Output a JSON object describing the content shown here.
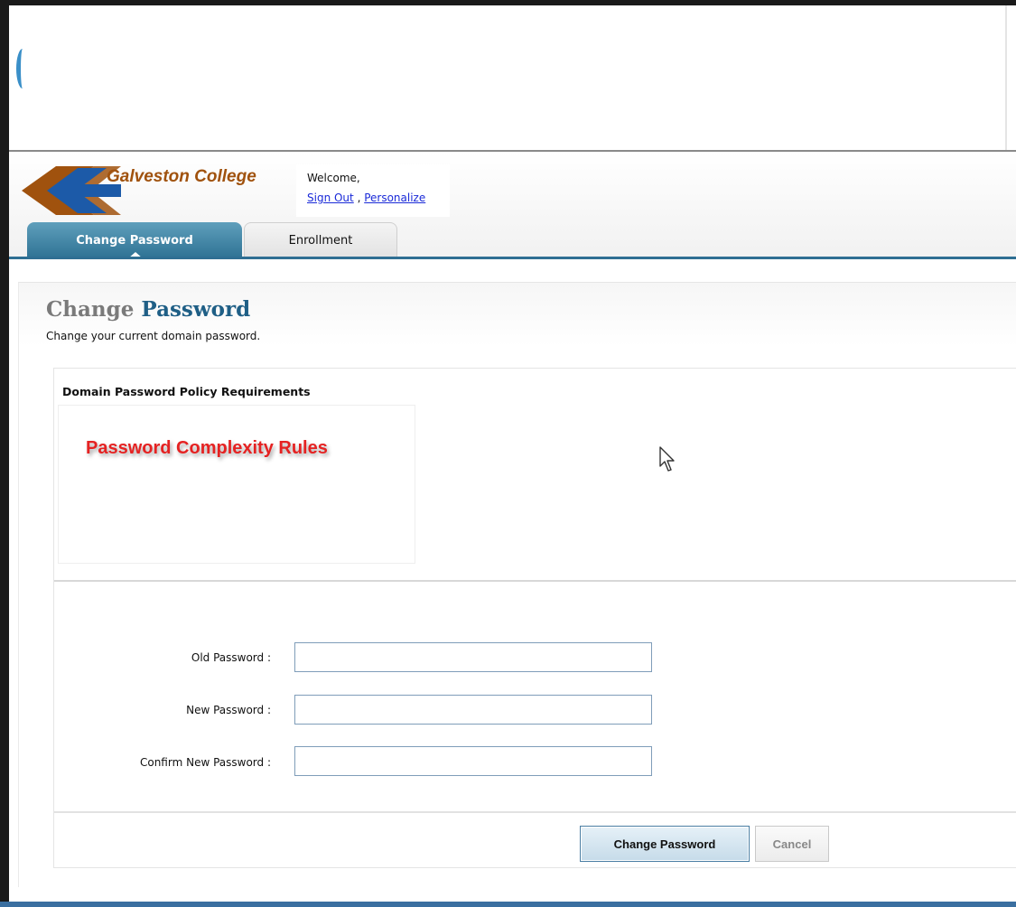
{
  "header": {
    "college_name": "Galveston College",
    "welcome": "Welcome,",
    "sign_out": "Sign Out",
    "separator": " , ",
    "personalize": "Personalize"
  },
  "tabs": [
    {
      "label": "Change Password",
      "active": true
    },
    {
      "label": "Enrollment",
      "active": false
    }
  ],
  "page": {
    "title_part1": "Change",
    "title_part2": "Password",
    "subtitle": "Change your current domain password."
  },
  "policy": {
    "heading": "Domain Password Policy Requirements",
    "rules_text": "Password Complexity Rules"
  },
  "form": {
    "old_password_label": "Old Password :",
    "new_password_label": "New Password :",
    "confirm_password_label": "Confirm New Password :",
    "old_password_value": "",
    "new_password_value": "",
    "confirm_password_value": ""
  },
  "buttons": {
    "submit": "Change Password",
    "cancel": "Cancel"
  },
  "colors": {
    "tab_active": "#2e7294",
    "title_accent": "#1f5f86",
    "rules_red": "#e52222",
    "link_blue": "#1a2ad8",
    "logo_brown": "#a0520e",
    "logo_blue": "#1c5aa8"
  },
  "icons": {
    "cursor": "mouse-pointer-icon"
  }
}
